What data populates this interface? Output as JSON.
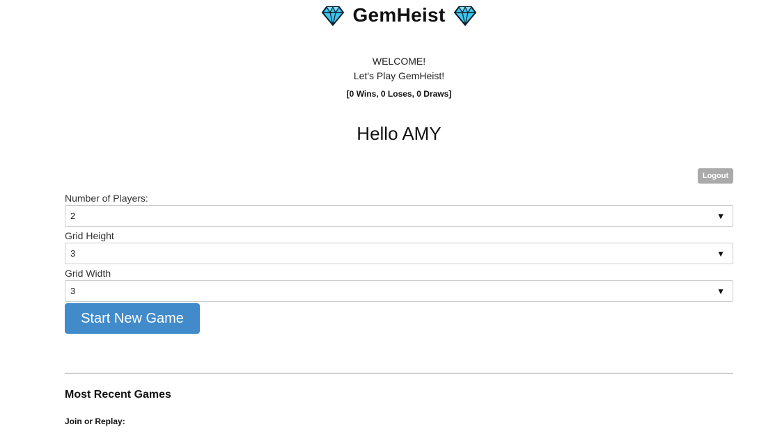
{
  "header": {
    "title": "GemHeist",
    "left_icon": "gem-icon",
    "right_icon": "gem-icon"
  },
  "welcome": {
    "line1": "WELCOME!",
    "line2": "Let's Play GemHeist!",
    "record": "[0 Wins, 0 Loses, 0 Draws]"
  },
  "greeting": "Hello AMY",
  "logout_label": "Logout",
  "form": {
    "players": {
      "label": "Number of Players:",
      "value": "2"
    },
    "height": {
      "label": "Grid Height",
      "value": "3"
    },
    "width": {
      "label": "Grid Width",
      "value": "3"
    },
    "dropdown_arrow": "▼"
  },
  "start_button": "Start New Game",
  "recent": {
    "title": "Most Recent Games",
    "join_label": "Join or Replay:"
  },
  "colors": {
    "primary_button": "#428bca",
    "logout_button": "#aaaaaa",
    "gem": "#3fc4ee"
  }
}
